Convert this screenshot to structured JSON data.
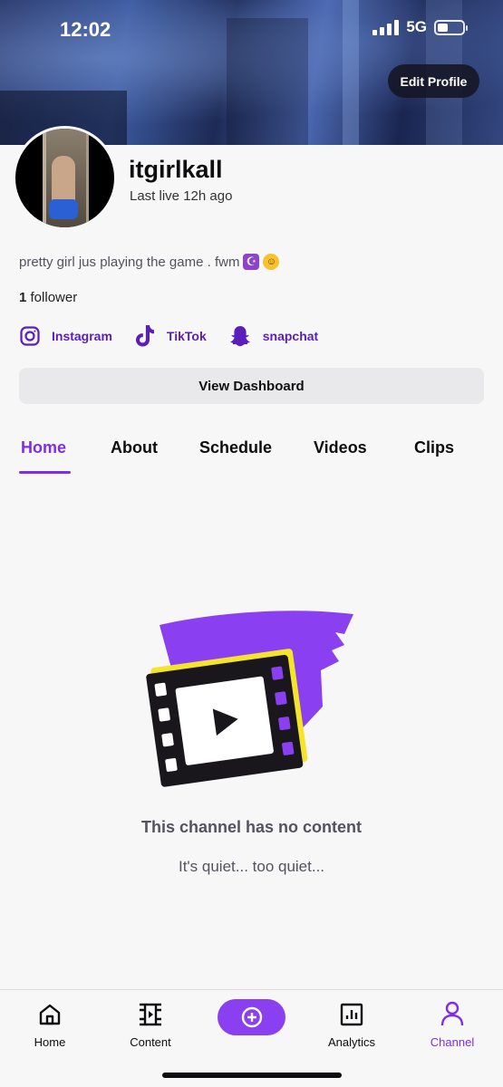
{
  "status_bar": {
    "time": "12:02",
    "network": "5G"
  },
  "profile": {
    "edit_label": "Edit Profile",
    "username": "itgirlkall",
    "last_live": "Last live 12h ago",
    "bio": "pretty girl jus playing the game . fwm",
    "followers_count": "1",
    "followers_label": "follower",
    "dashboard_label": "View Dashboard"
  },
  "socials": [
    {
      "icon": "instagram-icon",
      "label": "Instagram"
    },
    {
      "icon": "tiktok-icon",
      "label": "TikTok"
    },
    {
      "icon": "snapchat-icon",
      "label": "snapchat"
    }
  ],
  "tabs": [
    {
      "label": "Home",
      "active": true
    },
    {
      "label": "About"
    },
    {
      "label": "Schedule"
    },
    {
      "label": "Videos"
    },
    {
      "label": "Clips"
    }
  ],
  "empty_state": {
    "title": "This channel has no content",
    "subtitle": "It's quiet... too quiet..."
  },
  "bottom_nav": [
    {
      "label": "Home",
      "icon": "house-icon"
    },
    {
      "label": "Content",
      "icon": "film-icon"
    },
    {
      "label": "",
      "icon": "plus-circle-icon"
    },
    {
      "label": "Analytics",
      "icon": "chart-icon"
    },
    {
      "label": "Channel",
      "icon": "person-icon",
      "active": true
    }
  ],
  "colors": {
    "accent": "#7d2ee6",
    "social": "#5a1fb8",
    "create_button": "#8a3ff0"
  }
}
